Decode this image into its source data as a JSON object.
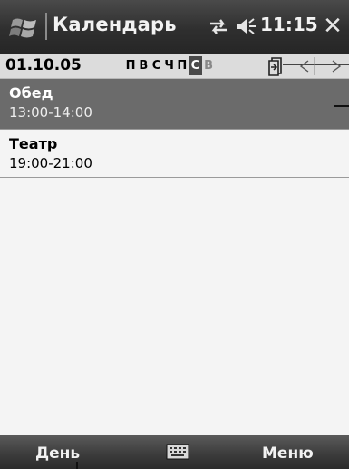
{
  "titlebar": {
    "title": "Календарь",
    "clock": "11:15",
    "close": "✕",
    "start_icon": "windows-flag-icon",
    "connectivity_icon": "sync-arrows-icon",
    "volume_icon": "speaker-icon"
  },
  "datebar": {
    "date": "01.10.05",
    "weekdays": [
      "П",
      "В",
      "С",
      "Ч",
      "П",
      "С",
      "В"
    ],
    "selected_weekday_index": 5,
    "dim_weekday_index": 6,
    "today_icon": "go-to-today-icon",
    "prev_icon": "prev-arrow-icon",
    "next_icon": "next-arrow-icon"
  },
  "appointments": [
    {
      "title": "Обед",
      "time": "13:00-14:00",
      "selected": true
    },
    {
      "title": "Театр",
      "time": "19:00-21:00",
      "selected": false
    }
  ],
  "softkeys": {
    "left": "День",
    "right": "Меню",
    "input_icon": "keyboard-icon"
  },
  "colors": {
    "titlebar": "#2f2f2f",
    "selection": "#6b6b6b",
    "background": "#f4f4f4",
    "datebar": "#dcdcdc"
  }
}
